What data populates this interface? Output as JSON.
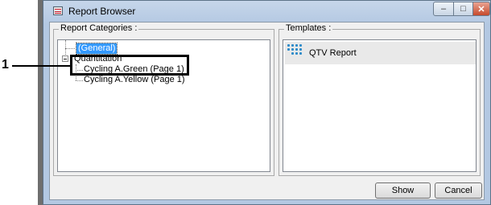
{
  "window": {
    "title": "Report Browser",
    "min_glyph": "‒",
    "max_glyph": "□",
    "close_glyph": "✕"
  },
  "categories": {
    "label": "Report Categories :",
    "items": [
      {
        "label": "(General)",
        "selected": true
      },
      {
        "label": "Quantitation"
      },
      {
        "label": "Cycling A.Green (Page 1)"
      },
      {
        "label": "Cycling A.Yellow (Page 1)"
      }
    ]
  },
  "templates": {
    "label": "Templates :",
    "items": [
      {
        "label": "QTV Report",
        "icon": "qiagen-logo-icon"
      }
    ]
  },
  "buttons": {
    "show": "Show",
    "cancel": "Cancel"
  },
  "callout": {
    "number": "1"
  }
}
